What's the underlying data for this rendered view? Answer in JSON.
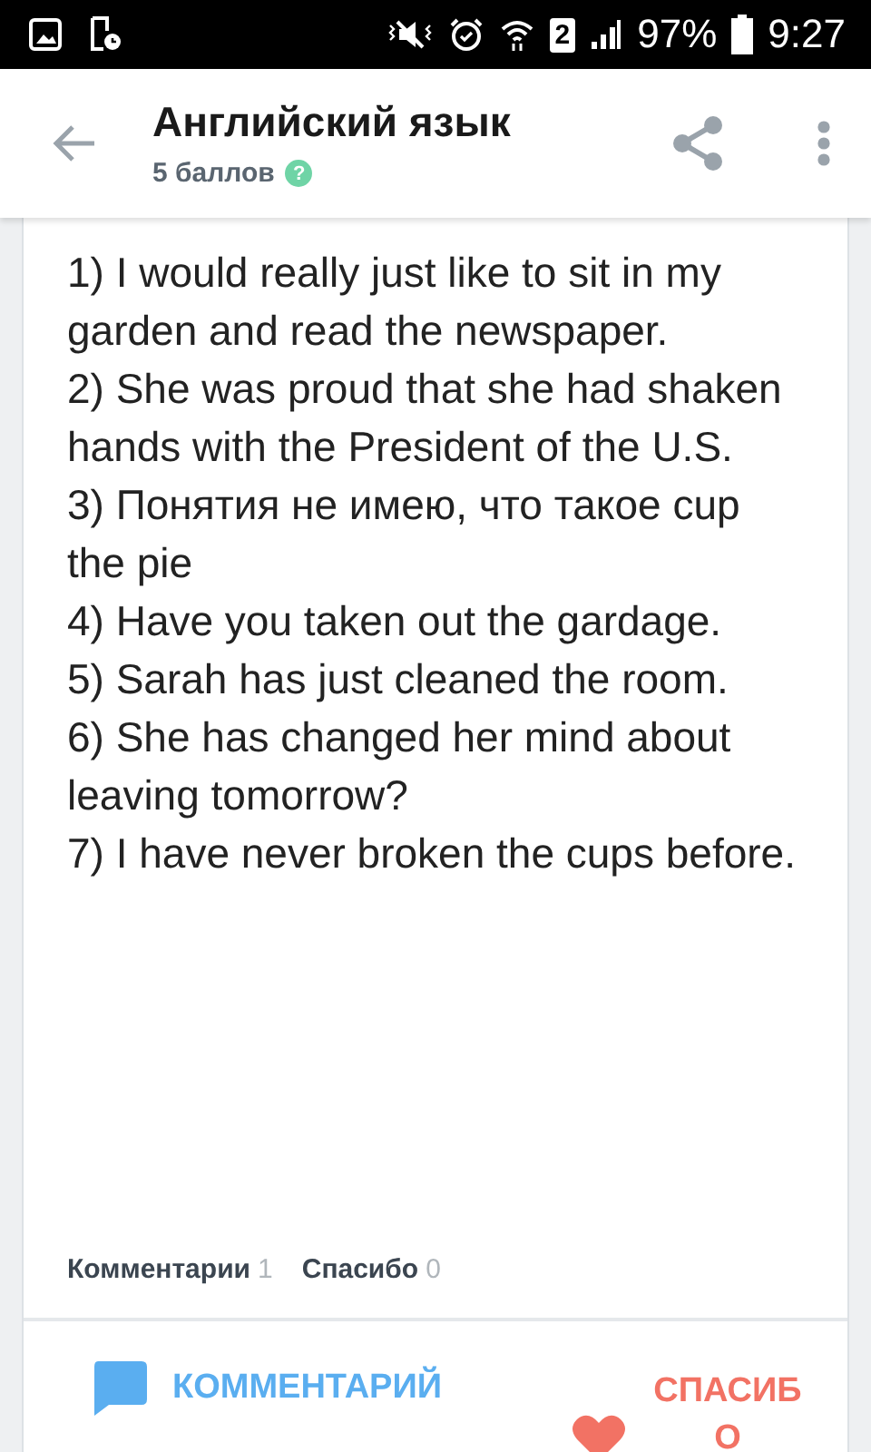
{
  "status_bar": {
    "battery": "97%",
    "time": "9:27",
    "sim": "2"
  },
  "header": {
    "title": "Английский язык",
    "points": "5 баллов",
    "help": "?"
  },
  "answer": {
    "lines": [
      "1) I would really just like to sit in my garden and read the newspaper.",
      "2) She was proud that she had shaken hands with the President of the U.S.",
      "3) Понятия не имею, что такое cup the pie",
      "4) Have you taken out the gardage.",
      "5) Sarah has just cleaned the room.",
      "6) She has changed her mind about leaving tomorrow?",
      "7) I have never broken the cups before."
    ]
  },
  "stats": [
    {
      "label": "Комментарии",
      "count": "1"
    },
    {
      "label": "Спасибо",
      "count": "0"
    }
  ],
  "actions": [
    {
      "kind": "comment",
      "label": "КОММЕНТАРИЙ"
    },
    {
      "kind": "thanks",
      "label": "СПАСИБО"
    }
  ]
}
